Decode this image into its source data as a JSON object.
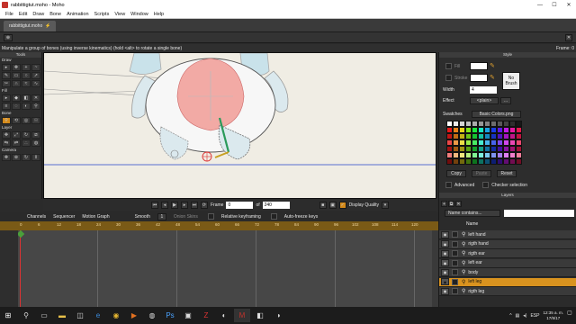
{
  "window": {
    "title": "rabbittigtut.moho - Moho",
    "min": "—",
    "max": "☐",
    "close": "✕"
  },
  "menu": [
    "File",
    "Edit",
    "Draw",
    "Bone",
    "Animation",
    "Scripts",
    "View",
    "Window",
    "Help"
  ],
  "document": {
    "tab": "rabbittigtut.moho",
    "tab_marker": "⚡"
  },
  "status": {
    "hint": "Manipulate a group of bones (using inverse kinematics) (hold <alt> to rotate a single bone)",
    "frame": "Frame: 0"
  },
  "tools": {
    "title": "Tools",
    "groups": [
      {
        "label": "Draw",
        "rows": 3
      },
      {
        "label": "Fill",
        "rows": 2
      },
      {
        "label": "Bone",
        "rows": 1
      },
      {
        "label": "Layer",
        "rows": 2
      },
      {
        "label": "Camera",
        "rows": 1
      }
    ]
  },
  "playback": {
    "frame_label": "Frame",
    "frame_value": "0",
    "of_label": "of",
    "total_value": "240",
    "display_quality": "Display Quality"
  },
  "timeline": {
    "tabs": [
      "Channels",
      "Sequencer",
      "Motion Graph"
    ],
    "interp": "Smooth",
    "interp_value": "1",
    "onion": "Onion Skins",
    "relative": "Relative keyframing",
    "autofreeze": "Auto-freeze keys",
    "ruler": [
      "0",
      "6",
      "12",
      "18",
      "24",
      "30",
      "36",
      "42",
      "48",
      "54",
      "60",
      "66",
      "72",
      "78",
      "84",
      "90",
      "96",
      "102",
      "108",
      "114",
      "120"
    ]
  },
  "style": {
    "title": "Style",
    "fill_label": "Fill",
    "stroke_label": "Stroke",
    "width_label": "Width",
    "width_value": "4",
    "no_brush": "No Brush",
    "effect_label": "Effect",
    "effect_value": "<plain>",
    "swatches_label": "Swatches",
    "swatches_value": "Basic Colors.png",
    "copy": "Copy",
    "paste": "Paste",
    "reset": "Reset",
    "advanced": "Advanced",
    "checker": "Checker selection",
    "fill_color": "#ffffff",
    "stroke_color": "#ffffff"
  },
  "layers": {
    "title": "Layers",
    "filter": "Name contains...",
    "name_col": "Name",
    "items": [
      {
        "name": "left hand",
        "selected": false
      },
      {
        "name": "rigth hand",
        "selected": false
      },
      {
        "name": "rigth ear",
        "selected": false
      },
      {
        "name": "left ear",
        "selected": false
      },
      {
        "name": "body",
        "selected": false
      },
      {
        "name": "left leg",
        "selected": true
      },
      {
        "name": "rigth leg",
        "selected": false
      }
    ]
  },
  "taskbar": {
    "time": "12:35 a. m.",
    "date": "17/9/17",
    "lang": "ESP"
  }
}
